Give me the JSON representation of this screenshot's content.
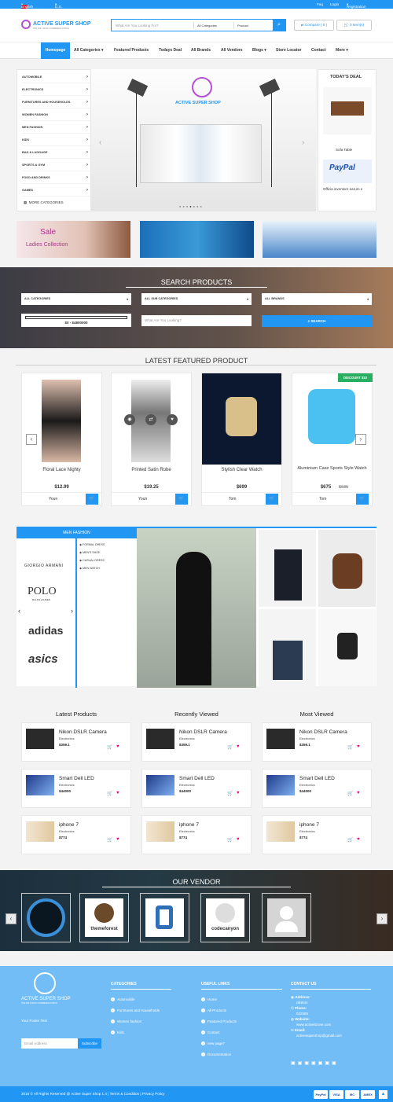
{
  "topbar": {
    "language": "English",
    "currency": "U.S. Dollar ($)",
    "faq": "Faq",
    "login": "Login",
    "register": "Registration"
  },
  "header": {
    "logo": "ACTIVE SUPER SHOP",
    "logo_tagline": "THE ONLY MULTI-COMMERCE PORTAL",
    "search_placeholder": "What Are You Looking For?",
    "cat_select": "All Categories",
    "type_select": "Product",
    "compare": "Compare ( 0 )",
    "cart": "0 Item(s)"
  },
  "nav": [
    "Homepage",
    "All Categories",
    "Featured Products",
    "Todays Deal",
    "All Brands",
    "All Vendors",
    "Blogs",
    "Store Locator",
    "Contact",
    "More"
  ],
  "categories": [
    "AUTOMOBILE",
    "ELECTRONICS",
    "FURNITURES AND HOUSEHOLDS",
    "WOMEN FASHION",
    "MEN FASHION",
    "KIDS",
    "BAG & LUGGAGE",
    "SPORTS & GYM",
    "FOOD AND DRINKS",
    "GAMES"
  ],
  "more_categories": "MORE CATEGORIES",
  "slider_logo": "ACTIVE SUPER SHOP",
  "deal": {
    "title": "TODAY'S DEAL",
    "item1": "Sofa Table",
    "item2": "Officia inventore earum e",
    "paypal": "PayPal"
  },
  "banners": {
    "sale": "Sale",
    "sale_sub": "Ladies Collection"
  },
  "search_products": {
    "title": "SEARCH PRODUCTS",
    "cat": "ALL CATEGORIES",
    "subcat": "ALL SUB CATEGORIES",
    "brand": "ALL BRANDS",
    "range": "$0 - $4800000",
    "placeholder": "What Are You Looking?",
    "button": "SEARCH"
  },
  "featured": {
    "title": "LATEST FEATURED PRODUCT",
    "discount": "DISCOUNT $10",
    "items": [
      {
        "name": "Floral Lace Nighty",
        "price": "$12.99",
        "old": "",
        "user": "Youn"
      },
      {
        "name": "Printed Satin Robe",
        "price": "$19.25",
        "old": "",
        "user": "Youn"
      },
      {
        "name": "Stylish Clear Watch",
        "price": "$699",
        "old": "",
        "user": "Tom"
      },
      {
        "name": "Aluminium Case Sports Style Watch",
        "price": "$675",
        "old": "$685",
        "user": "Tom"
      }
    ]
  },
  "brandpanel": {
    "title": "MEN FASHION",
    "brands": [
      "GIORGIO ARMANI",
      "POLO",
      "adidas",
      "asics"
    ],
    "polo_sub": "RALPH LAUREN",
    "subcats": [
      "FORMAL DRESS",
      "MEN'S SHOE",
      "CASUAL DRESS",
      "MEN WATCH"
    ]
  },
  "columns": [
    {
      "title": "Latest Products",
      "items": [
        {
          "name": "Nikon DSLR Camera",
          "cat": "Electronics",
          "price": "$359.1"
        },
        {
          "name": "Smart Dell LED",
          "cat": "Electronics",
          "price": "$44000"
        },
        {
          "name": "iphone 7",
          "cat": "Electronics",
          "price": "$774"
        }
      ]
    },
    {
      "title": "Recently Viewed",
      "items": [
        {
          "name": "Nikon DSLR Camera",
          "cat": "Electronics",
          "price": "$359.1"
        },
        {
          "name": "Smart Dell LED",
          "cat": "Electronics",
          "price": "$44000"
        },
        {
          "name": "iphone 7",
          "cat": "Electronics",
          "price": "$774"
        }
      ]
    },
    {
      "title": "Most Viewed",
      "items": [
        {
          "name": "Nikon DSLR Camera",
          "cat": "Electronics",
          "price": "$359.1"
        },
        {
          "name": "Smart Dell LED",
          "cat": "Electronics",
          "price": "$44000"
        },
        {
          "name": "iphone 7",
          "cat": "Electronics",
          "price": "$774"
        }
      ]
    }
  ],
  "vendor": {
    "title": "OUR VENDOR",
    "names": [
      "themeforest",
      "codecanyon"
    ]
  },
  "footer": {
    "logo": "ACTIVE SUPER SHOP",
    "logo_tagline": "THE ONLY MULTI-COMMERCE PORTAL",
    "text": "Your Footer Text",
    "email_placeholder": "Email Address",
    "subscribe": "Subscribe",
    "categories_title": "CATEGORIES",
    "categories": [
      "Automobile",
      "Furnitures and Households",
      "Women fashion",
      "Kids"
    ],
    "links_title": "USEFUL LINKS",
    "links": [
      "Home",
      "All Products",
      "Featured Products",
      "Contact",
      "new page7",
      "Documentation"
    ],
    "contact_title": "CONTACT US",
    "address_label": "Address:",
    "address": "niketon",
    "phone_label": "Phone:",
    "phone": "022555",
    "website_label": "Website:",
    "website": "www.activeitzone.com",
    "email_label": "Email:",
    "email": "activesupershop@gmail.com"
  },
  "bottom": {
    "copyright": "2016 © All Rights Reserved @ Active Super Shop 1.4 | Terms & Condition | Privacy Policy",
    "payments": [
      "PayPal",
      "VISA",
      "MC",
      "AMEX"
    ]
  },
  "colors": {
    "primary": "#2196f3",
    "footer": "#72bdf6",
    "discount": "#27ae60"
  }
}
